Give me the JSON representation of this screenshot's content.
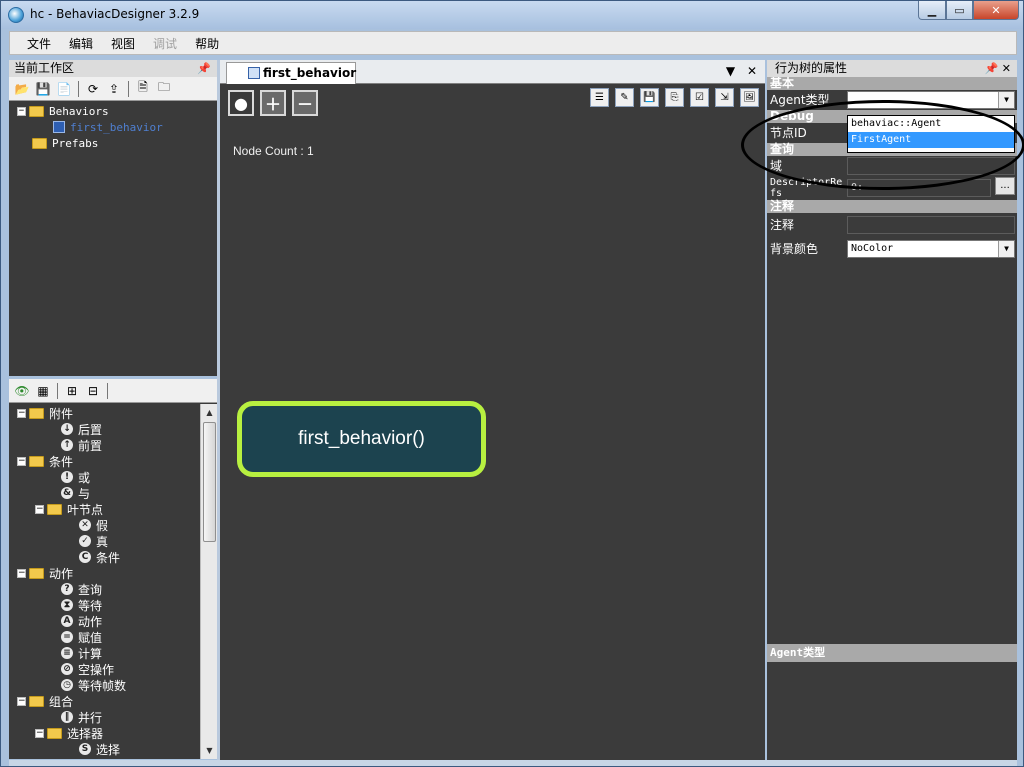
{
  "window": {
    "title": "hc - BehaviacDesigner 3.2.9"
  },
  "menu": [
    {
      "label": "文件",
      "disabled": false
    },
    {
      "label": "编辑",
      "disabled": false
    },
    {
      "label": "视图",
      "disabled": false
    },
    {
      "label": "调试",
      "disabled": true
    },
    {
      "label": "帮助",
      "disabled": false
    }
  ],
  "workspace": {
    "title": "当前工作区",
    "tree": [
      {
        "label": "Behaviors",
        "type": "folder",
        "expander": "−",
        "indent": 0
      },
      {
        "label": "first_behavior",
        "type": "file",
        "indent": 1
      },
      {
        "label": "Prefabs",
        "type": "folder",
        "indent": 0
      }
    ]
  },
  "nodes_panel": {
    "items": [
      {
        "label": "附件",
        "kind": "folder",
        "expander": "−",
        "indent": 0
      },
      {
        "label": "后置",
        "kind": "node",
        "glyph": "↓",
        "indent": 1
      },
      {
        "label": "前置",
        "kind": "node",
        "glyph": "↑",
        "indent": 1
      },
      {
        "label": "条件",
        "kind": "folder",
        "expander": "−",
        "indent": 0
      },
      {
        "label": "或",
        "kind": "node",
        "glyph": "!",
        "indent": 1
      },
      {
        "label": "与",
        "kind": "node",
        "glyph": "&",
        "indent": 1
      },
      {
        "label": "叶节点",
        "kind": "folder",
        "expander": "−",
        "indent": 1
      },
      {
        "label": "假",
        "kind": "node",
        "glyph": "✕",
        "indent": 2
      },
      {
        "label": "真",
        "kind": "node",
        "glyph": "✓",
        "indent": 2
      },
      {
        "label": "条件",
        "kind": "node",
        "glyph": "C",
        "indent": 2
      },
      {
        "label": "动作",
        "kind": "folder",
        "expander": "−",
        "indent": 0
      },
      {
        "label": "查询",
        "kind": "node",
        "glyph": "?",
        "indent": 1
      },
      {
        "label": "等待",
        "kind": "node",
        "glyph": "⧗",
        "indent": 1
      },
      {
        "label": "动作",
        "kind": "node",
        "glyph": "A",
        "indent": 1
      },
      {
        "label": "赋值",
        "kind": "node",
        "glyph": "=",
        "indent": 1
      },
      {
        "label": "计算",
        "kind": "node",
        "glyph": "≡",
        "indent": 1
      },
      {
        "label": "空操作",
        "kind": "node",
        "glyph": "⊘",
        "indent": 1
      },
      {
        "label": "等待帧数",
        "kind": "node",
        "glyph": "◷",
        "indent": 1
      },
      {
        "label": "组合",
        "kind": "folder",
        "expander": "−",
        "indent": 0
      },
      {
        "label": "并行",
        "kind": "node",
        "glyph": "‖",
        "indent": 1
      },
      {
        "label": "选择器",
        "kind": "folder",
        "expander": "−",
        "indent": 1
      },
      {
        "label": "选择",
        "kind": "node",
        "glyph": "S",
        "indent": 2
      }
    ]
  },
  "editor": {
    "tab_label": "first_behavior",
    "tab_controls": {
      "menu": "▼",
      "close": "✕"
    },
    "node_count": "Node Count : 1",
    "root_node_label": "first_behavior()"
  },
  "properties": {
    "title": "行为树的属性",
    "categories": {
      "basic": "基本",
      "debug": "Debug",
      "query": "查询",
      "comment": "注释"
    },
    "fields": {
      "agent_type_label": "Agent类型",
      "agent_type_value": "",
      "node_id_label": "节点ID",
      "domain_label": "域",
      "domain_value": "",
      "descriptor_label": "DescriptorRefs",
      "descriptor_value": "0:",
      "descriptor_button": "...",
      "comment_label": "注释",
      "comment_value": "",
      "bg_color_label": "背景颜色",
      "bg_color_value": "NoColor"
    },
    "dropdown_options": [
      {
        "label": "behaviac::Agent",
        "selected": false
      },
      {
        "label": "FirstAgent",
        "selected": true
      }
    ],
    "help_title": "Agent类型"
  },
  "colors": {
    "node_border": "#b8f040",
    "node_fill": "#1c434f",
    "canvas_bg": "#3b3b3b",
    "selection": "#3399ff"
  }
}
